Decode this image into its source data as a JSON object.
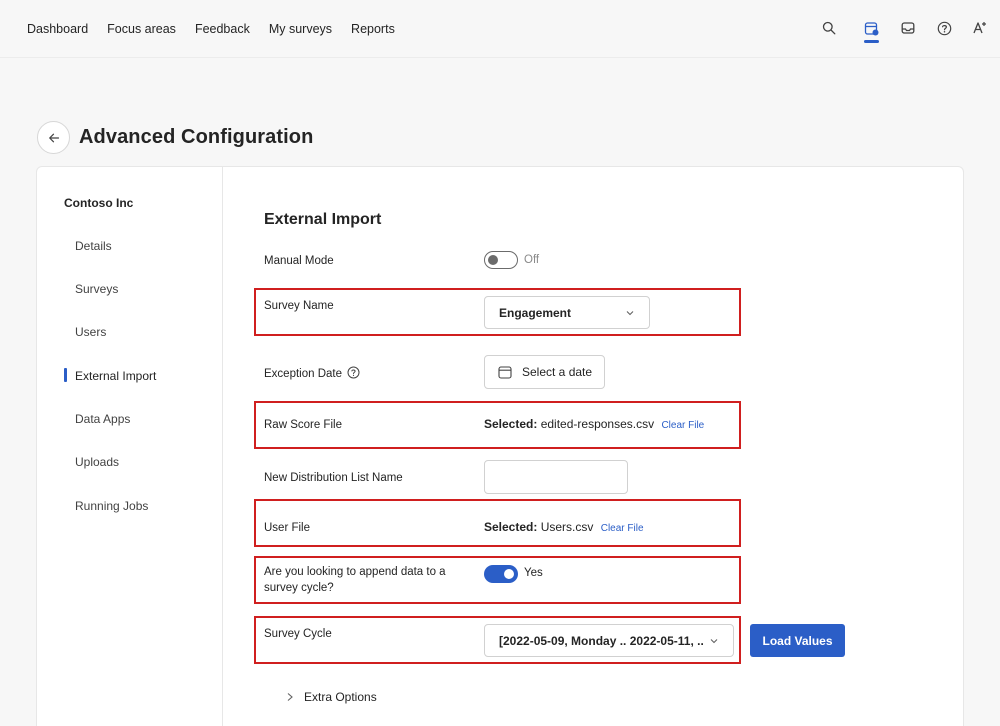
{
  "nav": {
    "items": [
      {
        "label": "Dashboard"
      },
      {
        "label": "Focus areas"
      },
      {
        "label": "Feedback"
      },
      {
        "label": "My surveys"
      },
      {
        "label": "Reports"
      }
    ],
    "icons": [
      "search-icon",
      "calendar-settings-icon",
      "inbox-icon",
      "help-icon",
      "accessibility-icon"
    ],
    "accent_color": "#2b5ec7"
  },
  "page": {
    "title": "Advanced Configuration"
  },
  "sidebar": {
    "org": "Contoso Inc",
    "items": [
      {
        "label": "Details"
      },
      {
        "label": "Surveys"
      },
      {
        "label": "Users"
      },
      {
        "label": "External Import"
      },
      {
        "label": "Data Apps"
      },
      {
        "label": "Uploads"
      },
      {
        "label": "Running Jobs"
      }
    ],
    "active": "External Import"
  },
  "form": {
    "section_title": "External Import",
    "manual_mode": {
      "label": "Manual Mode",
      "state": "Off"
    },
    "survey_name": {
      "label": "Survey Name",
      "value": "Engagement"
    },
    "exception_date": {
      "label": "Exception Date",
      "button": "Select a date"
    },
    "raw_score_file": {
      "label": "Raw Score File",
      "selected_label": "Selected:",
      "file": "edited-responses.csv",
      "clear": "Clear File"
    },
    "new_distribution_list": {
      "label": "New Distribution List Name",
      "value": ""
    },
    "user_file": {
      "label": "User File",
      "selected_label": "Selected:",
      "file": "Users.csv",
      "clear": "Clear File"
    },
    "append": {
      "label_line1": "Are you looking to append data to a",
      "label_line2": "survey cycle?",
      "state": "Yes"
    },
    "survey_cycle": {
      "label": "Survey Cycle",
      "value": "[2022-05-09, Monday .. 2022-05-11, ..."
    },
    "load_button": "Load Values",
    "extra_options": "Extra Options"
  },
  "highlight_color": "#d01f1f"
}
